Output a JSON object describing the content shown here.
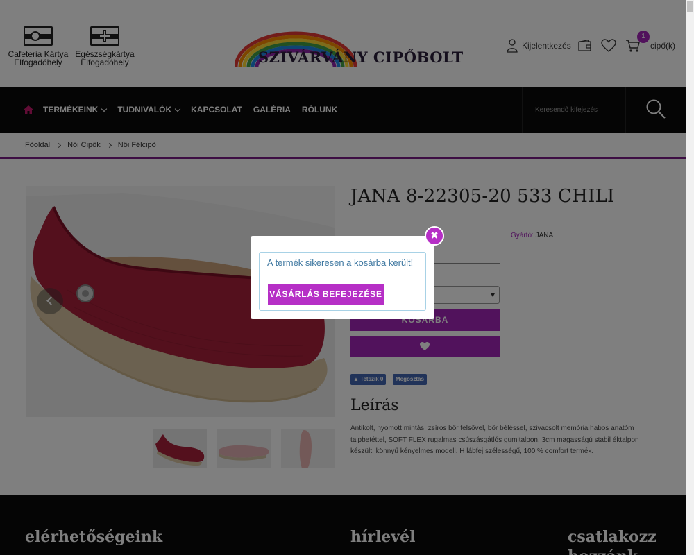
{
  "header": {
    "cards": [
      {
        "label": "Cafeteria Kártya Elfogadóhely",
        "icon": "cafeteria-card-icon"
      },
      {
        "label": "Egészségkártya Elfogadóhely",
        "icon": "health-card-icon"
      }
    ],
    "logo_text": "SZIVÁRVÁNY CIPŐBOLT",
    "login_label": "Kijelentkezés",
    "cart_count": "1",
    "cart_label": "cipő(k)",
    "accent_color": "#a325b8"
  },
  "nav": {
    "items": [
      {
        "label": "TERMÉKEINK",
        "dropdown": true
      },
      {
        "label": "TUDNIVALÓK",
        "dropdown": true
      },
      {
        "label": "KAPCSOLAT",
        "dropdown": false
      },
      {
        "label": "GALÉRIA",
        "dropdown": false
      },
      {
        "label": "RÓLUNK",
        "dropdown": false
      }
    ],
    "search_placeholder": "Keresendő kifejezés"
  },
  "breadcrumb": [
    "Főoldal",
    "Női Cipők",
    "Női Félcipő"
  ],
  "product": {
    "title": "JANA 8-22305-20 533 CHILI",
    "maker_key": "Gyártó:",
    "maker_value": "JANA",
    "add_to_cart": "KOSÁRBA",
    "fb_like": "Tetszik 0",
    "fb_share": "Megosztás",
    "description_title": "Leírás",
    "description": "Antikolt, nyomott mintás, zsíros bőr felsővel, bőr béléssel, szivacsolt memória habos anatóm talpbetéttel, SOFT FLEX rugalmas csúszásgátlós gumitalpon, 3cm magasságú stabil éktalpon készült, könnyű kényelmes modell. H lábfej szélességű, 100 % comfort termék."
  },
  "footer": {
    "headings": [
      "elérhetőségeink",
      "hírlevél",
      "csatlakozz hozzánk"
    ]
  },
  "modal": {
    "message": "A termék sikeresen a kosárba került!",
    "button": "VÁSÁRLÁS BEFEJEZÉSE",
    "close_glyph": "✖"
  }
}
